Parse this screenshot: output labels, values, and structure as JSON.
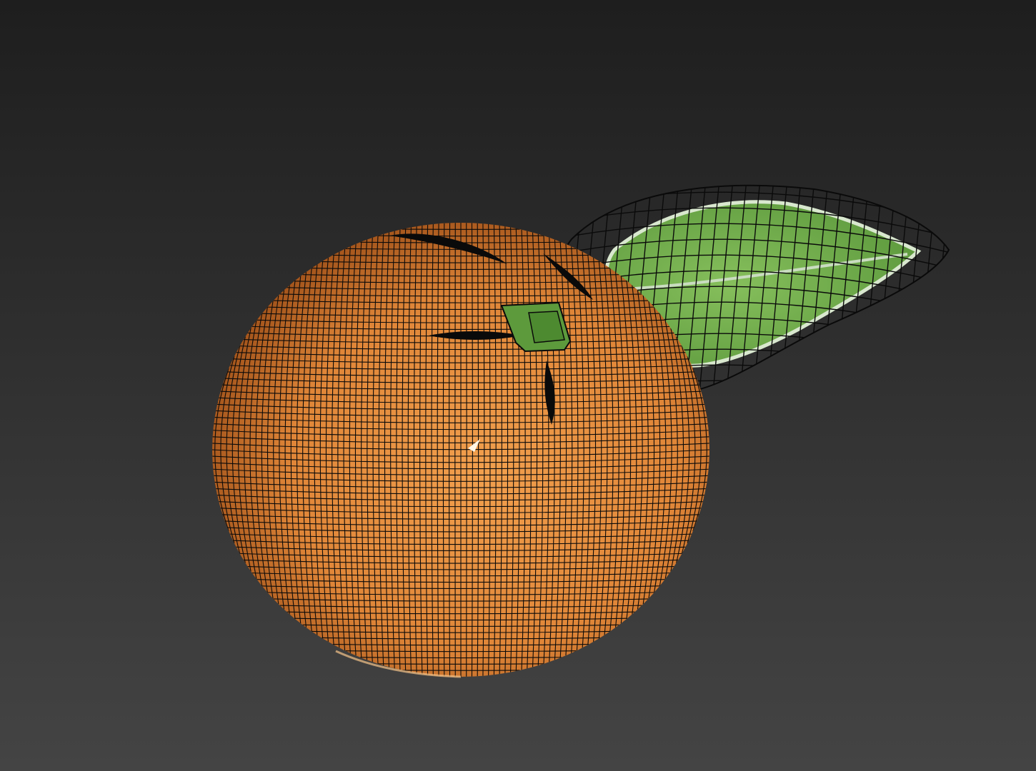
{
  "scene": {
    "background_top": "#1e1e1e",
    "background_bottom": "#444444",
    "wireframe_color": "#0a0a0a",
    "objects": [
      {
        "name": "orange",
        "fill": "#e08638",
        "highlight": "#f7c58a",
        "shadow": "#8a4010"
      },
      {
        "name": "leaf",
        "fill": "#6fae4a",
        "edge": "#d9e8cf",
        "vein": "#c9dcc0"
      },
      {
        "name": "stem",
        "fill": "#5d9a3c"
      }
    ]
  }
}
